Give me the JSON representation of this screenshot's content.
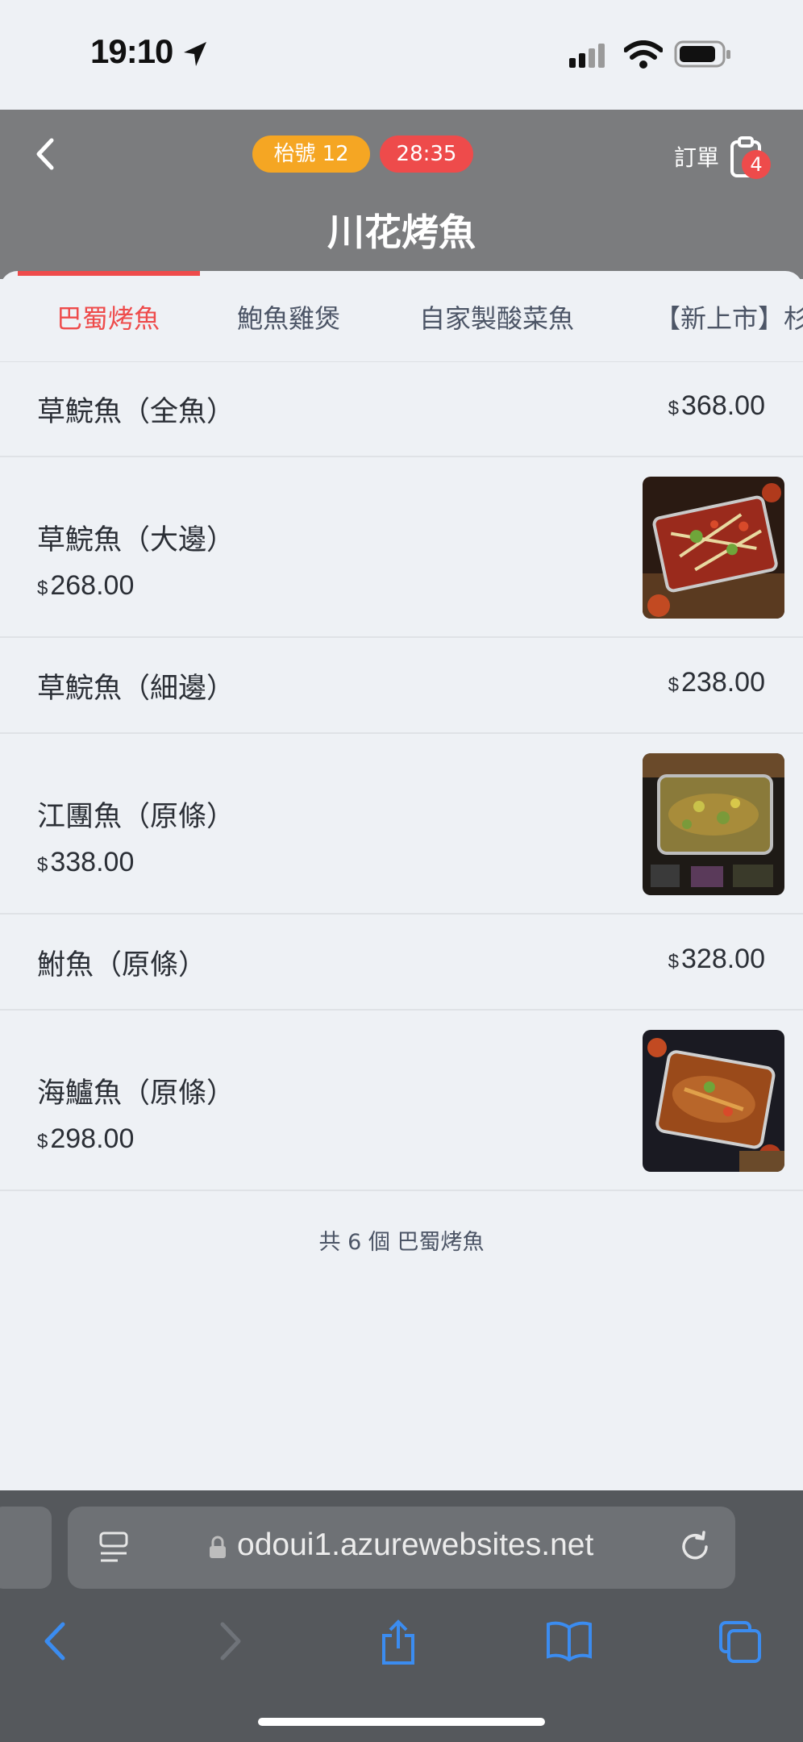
{
  "status_bar": {
    "time": "19:10"
  },
  "header": {
    "table_badge": "枱號 12",
    "timer_badge": "28:35",
    "order_label": "訂單",
    "order_count": "4",
    "store_title": "川花烤魚"
  },
  "tabs": [
    {
      "label": "巴蜀烤魚",
      "active": true
    },
    {
      "label": "鮑魚雞煲",
      "active": false
    },
    {
      "label": "自家製酸菜魚",
      "active": false
    },
    {
      "label": "【新上市】杉",
      "active": false
    }
  ],
  "items": [
    {
      "name": "草鯇魚（全魚）",
      "currency": "$",
      "price": "368.00",
      "has_image": false
    },
    {
      "name": "草鯇魚（大邊）",
      "currency": "$",
      "price": "268.00",
      "has_image": true
    },
    {
      "name": "草鯇魚（細邊）",
      "currency": "$",
      "price": "238.00",
      "has_image": false
    },
    {
      "name": "江團魚（原條）",
      "currency": "$",
      "price": "338.00",
      "has_image": true
    },
    {
      "name": "鮒魚（原條）",
      "currency": "$",
      "price": "328.00",
      "has_image": false
    },
    {
      "name": "海鱸魚（原條）",
      "currency": "$",
      "price": "298.00",
      "has_image": true
    }
  ],
  "summary": "共 6 個 巴蜀烤魚",
  "browser": {
    "url": "odoui1.azurewebsites.net"
  },
  "colors": {
    "accent": "#ee4b4b",
    "table_badge": "#f5a623",
    "header_bg": "#7b7c7e"
  }
}
